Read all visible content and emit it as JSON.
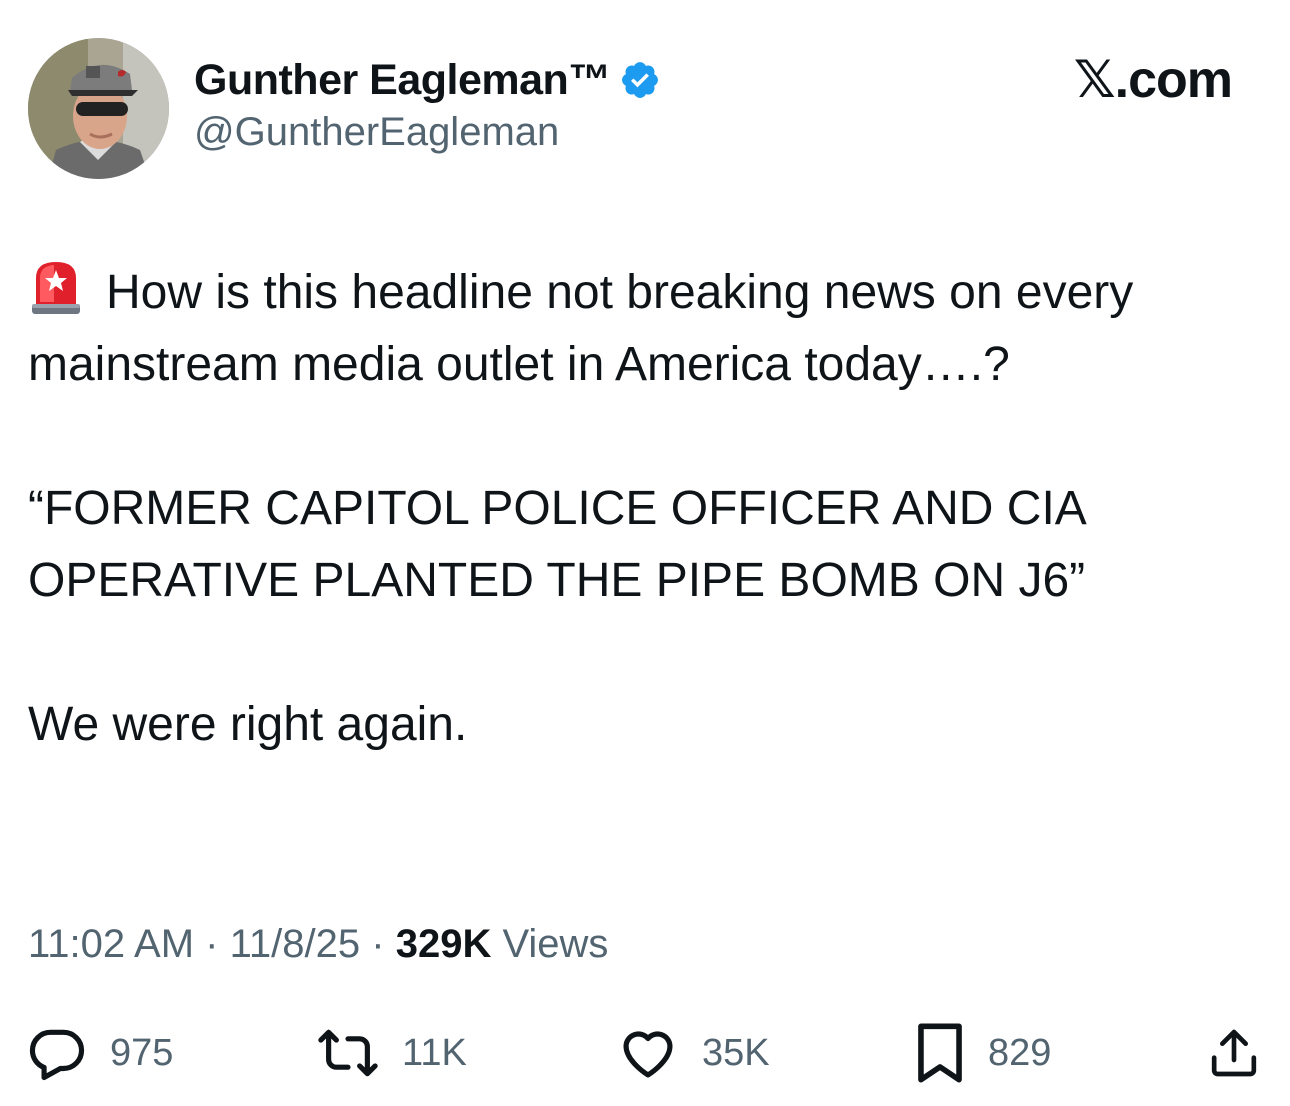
{
  "header": {
    "display_name": "Gunther Eagleman™",
    "handle": "@GuntherEagleman",
    "brand": "𝕏.com",
    "verified_color": "#1d9bf0",
    "avatar_icon": "profile-photo"
  },
  "tweet": {
    "emoji_icon": "police-siren-emoji",
    "paragraphs": [
      "How is this headline not breaking news on every mainstream media outlet in America today….?",
      "“FORMER CAPITOL POLICE OFFICER AND CIA OPERATIVE PLANTED THE PIPE BOMB ON J6”",
      "We were right again."
    ]
  },
  "meta": {
    "time": "11:02 AM",
    "separator": "·",
    "date": "11/8/25",
    "views_count": "329K",
    "views_label": "Views"
  },
  "actions": {
    "replies": "975",
    "reposts": "11K",
    "likes": "35K",
    "bookmarks": "829"
  },
  "colors": {
    "text_primary": "#0f1419",
    "text_secondary": "#536471",
    "accent": "#1d9bf0",
    "siren_red": "#e0202a"
  }
}
